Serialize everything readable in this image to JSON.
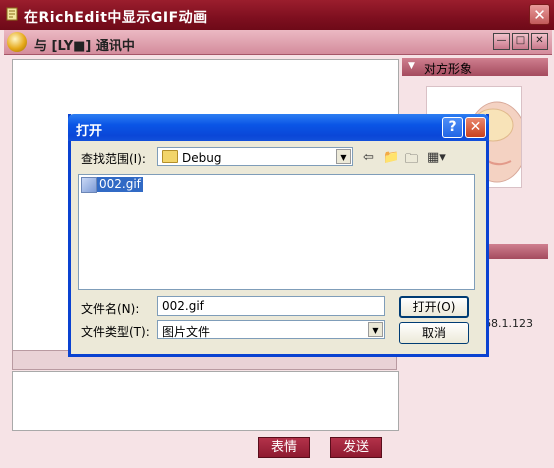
{
  "app": {
    "title": "在RichEdit中显示GIF动画",
    "close": "✕"
  },
  "chat": {
    "title": "与 [LY■] 通讯中",
    "win_min": "—",
    "win_max": "□",
    "win_close": "✕",
    "side_header": "对方形象",
    "ip_tail": "68.1.123",
    "emoticon_button": "表情",
    "send_button": "发送"
  },
  "dialog": {
    "title": "打开",
    "help": "?",
    "close": "✕",
    "lookin_label": "查找范围(I):",
    "lookin_value": "Debug",
    "files": [
      {
        "name": "002.gif",
        "selected": true
      }
    ],
    "filename_label": "文件名(N):",
    "filename_value": "002.gif",
    "filetype_label": "文件类型(T):",
    "filetype_value": "图片文件",
    "open_button": "打开(O)",
    "cancel_button": "取消"
  },
  "colors": {
    "xp_title": "#0a47d8",
    "chat_accent": "#a44b5e",
    "selection": "#316ac5"
  }
}
